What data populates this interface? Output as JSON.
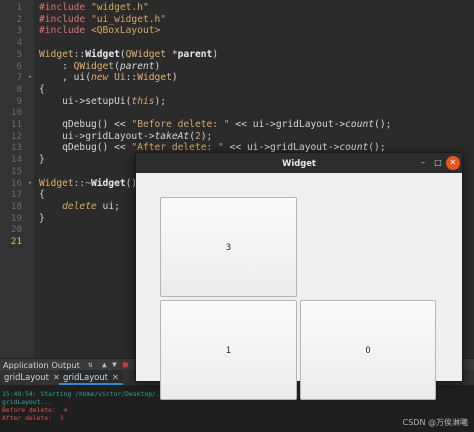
{
  "editor": {
    "lines": [
      {
        "n": "1",
        "tokens": [
          [
            "pp",
            "#include "
          ],
          [
            "str",
            "\"widget.h\""
          ]
        ]
      },
      {
        "n": "2",
        "tokens": [
          [
            "pp",
            "#include "
          ],
          [
            "str",
            "\"ui_widget.h\""
          ]
        ]
      },
      {
        "n": "3",
        "tokens": [
          [
            "pp",
            "#include "
          ],
          [
            "str",
            "<QBoxLayout>"
          ]
        ]
      },
      {
        "n": "4",
        "tokens": []
      },
      {
        "n": "5",
        "tokens": [
          [
            "cls",
            "Widget"
          ],
          [
            "op",
            "::"
          ],
          [
            "fn",
            "Widget"
          ],
          [
            "plain",
            "("
          ],
          [
            "cls",
            "QWidget"
          ],
          [
            "plain",
            " *"
          ],
          [
            "fn",
            "parent"
          ],
          [
            "plain",
            ")"
          ]
        ]
      },
      {
        "n": "6",
        "tokens": [
          [
            "plain",
            "    : "
          ],
          [
            "cls",
            "QWidget"
          ],
          [
            "plain",
            "("
          ],
          [
            "it",
            "parent"
          ],
          [
            "plain",
            ")"
          ]
        ]
      },
      {
        "n": "7",
        "fold": true,
        "tokens": [
          [
            "plain",
            "    , ui("
          ],
          [
            "kw",
            "new "
          ],
          [
            "cls",
            "Ui"
          ],
          [
            "op",
            "::"
          ],
          [
            "cls",
            "Widget"
          ],
          [
            "plain",
            ")"
          ]
        ]
      },
      {
        "n": "8",
        "tokens": [
          [
            "plain",
            "{"
          ]
        ]
      },
      {
        "n": "9",
        "tokens": [
          [
            "plain",
            "    ui->setupUi("
          ],
          [
            "kw",
            "this"
          ],
          [
            "plain",
            ");"
          ]
        ]
      },
      {
        "n": "10",
        "tokens": []
      },
      {
        "n": "11",
        "tokens": [
          [
            "plain",
            "    qDebug() << "
          ],
          [
            "str",
            "\"Before delete: \""
          ],
          [
            "plain",
            " << ui->gridLayout->"
          ],
          [
            "it",
            "count"
          ],
          [
            "plain",
            "();"
          ]
        ]
      },
      {
        "n": "12",
        "tokens": [
          [
            "plain",
            "    ui->gridLayout->"
          ],
          [
            "it",
            "takeAt"
          ],
          [
            "plain",
            "("
          ],
          [
            "num",
            "2"
          ],
          [
            "plain",
            ");"
          ]
        ]
      },
      {
        "n": "13",
        "tokens": [
          [
            "plain",
            "    qDebug() << "
          ],
          [
            "str",
            "\"After delete: \""
          ],
          [
            "plain",
            " << ui->gridLayout->"
          ],
          [
            "it",
            "count"
          ],
          [
            "plain",
            "();"
          ]
        ]
      },
      {
        "n": "14",
        "tokens": [
          [
            "plain",
            "}"
          ]
        ]
      },
      {
        "n": "15",
        "tokens": []
      },
      {
        "n": "16",
        "fold": true,
        "tokens": [
          [
            "cls",
            "Widget"
          ],
          [
            "op",
            "::~"
          ],
          [
            "fn",
            "Widget"
          ],
          [
            "plain",
            "()"
          ]
        ]
      },
      {
        "n": "17",
        "tokens": [
          [
            "plain",
            "{"
          ]
        ]
      },
      {
        "n": "18",
        "tokens": [
          [
            "plain",
            "    "
          ],
          [
            "kw",
            "delete"
          ],
          [
            "plain",
            " ui;"
          ]
        ]
      },
      {
        "n": "19",
        "tokens": [
          [
            "plain",
            "}"
          ]
        ]
      },
      {
        "n": "20",
        "tokens": []
      },
      {
        "n": "21",
        "current": true,
        "tokens": []
      }
    ]
  },
  "output_pane": {
    "title": "Application Output",
    "tool_icons": [
      "filter-icon",
      "up-arrow-icon",
      "down-arrow-icon",
      "stop-icon",
      "run-icon"
    ],
    "tabs": [
      {
        "label": "gridLayout",
        "active": false
      },
      {
        "label": "gridLayout",
        "active": true
      }
    ],
    "lines": [
      {
        "text": "15:49:54: Starting /home/victor/Desktop/...",
        "color": "green"
      },
      {
        "text": "gridLayout...",
        "color": "green"
      },
      {
        "text": "Before delete:  4",
        "color": "red"
      },
      {
        "text": "After delete:  3",
        "color": "red"
      }
    ]
  },
  "widget_window": {
    "title": "Widget",
    "minimize": "–",
    "maximize": "□",
    "close": "✕",
    "buttons": [
      {
        "label": "3",
        "name": "grid-button-3"
      },
      {
        "label": "1",
        "name": "grid-button-1"
      },
      {
        "label": "0",
        "name": "grid-button-0"
      }
    ]
  },
  "watermark": "CSDN @万俟淋曦",
  "colors": {
    "editor_bg": "#2b2b2b",
    "close_button": "#e95420",
    "tab_accent": "#2e8bd6"
  }
}
